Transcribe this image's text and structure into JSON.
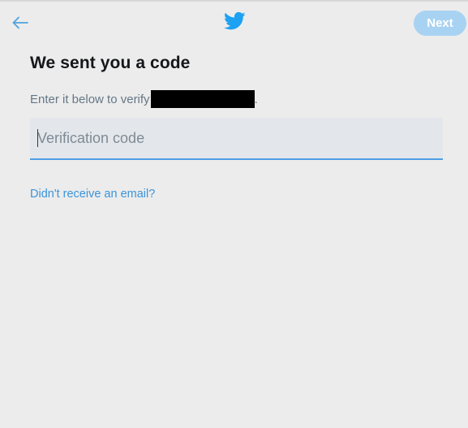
{
  "header": {
    "back_icon": "arrow-left-icon",
    "logo_icon": "twitter-bird-icon",
    "next_label": "Next"
  },
  "main": {
    "title": "We sent you a code",
    "subtitle_prefix": "Enter it below to verify",
    "subtitle_suffix": ".",
    "code_input": {
      "value": "",
      "placeholder": "Verification code"
    },
    "resend_link": "Didn't receive an email?"
  },
  "colors": {
    "accent": "#1da1f2",
    "next_button_disabled": "#a8d2f2",
    "link": "#3b94d9",
    "input_underline": "#4f9ee6",
    "background": "#ececec"
  }
}
